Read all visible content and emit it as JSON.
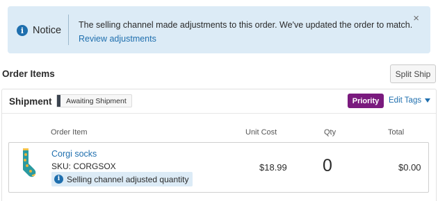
{
  "notice": {
    "icon": "info-icon",
    "title": "Notice",
    "message": "The selling channel made adjustments to this order. We've updated the order to match.",
    "link": "Review adjustments",
    "close": "×"
  },
  "order_items": {
    "title": "Order Items",
    "split_ship_label": "Split Ship"
  },
  "shipment": {
    "title": "Shipment",
    "status": "Awaiting Shipment",
    "priority_label": "Priority",
    "edit_tags_label": "Edit Tags",
    "columns": {
      "item": "Order Item",
      "unit_cost": "Unit Cost",
      "qty": "Qty",
      "total": "Total"
    },
    "items": [
      {
        "name": "Corgi socks",
        "sku": "SKU: CORGSOX",
        "adjustment_note": "Selling channel adjusted quantity",
        "unit_cost": "$18.99",
        "qty": "0",
        "total": "$0.00"
      }
    ]
  },
  "colors": {
    "notice_bg": "#dcebf6",
    "link": "#1f6fae",
    "priority": "#7a1a7e",
    "status_bar": "#3c4450"
  }
}
